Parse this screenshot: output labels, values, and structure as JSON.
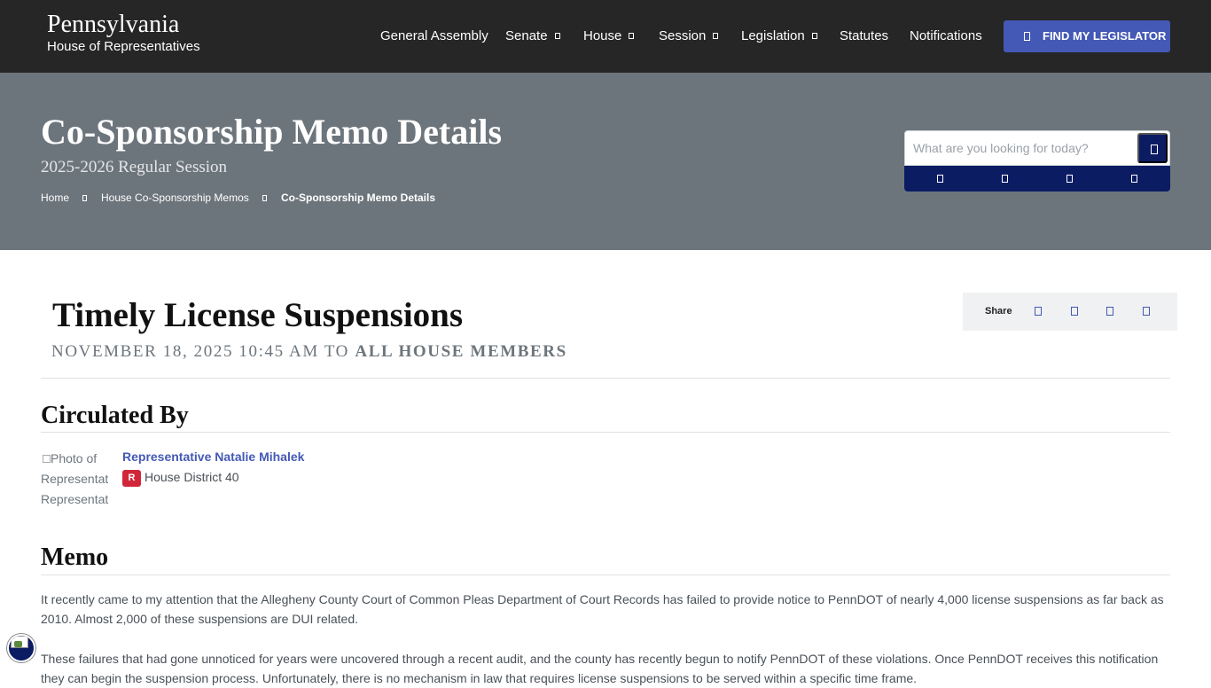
{
  "site": {
    "title": "Pennsylvania",
    "subtitle": "House of Representatives"
  },
  "nav": {
    "items": [
      {
        "label": "General Assembly",
        "has_dropdown": false
      },
      {
        "label": "Senate",
        "has_dropdown": true
      },
      {
        "label": "House",
        "has_dropdown": true
      },
      {
        "label": "Session",
        "has_dropdown": true
      },
      {
        "label": "Legislation",
        "has_dropdown": true
      },
      {
        "label": "Statutes",
        "has_dropdown": false
      },
      {
        "label": "Notifications",
        "has_dropdown": false
      }
    ],
    "cta_label": "FIND MY LEGISLATOR"
  },
  "hero": {
    "title": "Co-Sponsorship Memo Details",
    "subtitle": "2025-2026 Regular Session",
    "breadcrumbs": [
      "Home",
      "House Co-Sponsorship Memos",
      "Co-Sponsorship Memo Details"
    ]
  },
  "search": {
    "placeholder": "What are you looking for today?",
    "quick_icons": [
      "quick-link-icon-1",
      "quick-link-icon-2",
      "quick-link-icon-3",
      "quick-link-icon-4"
    ]
  },
  "memo": {
    "title": "Timely License Suspensions",
    "date": "NOVEMBER 18, 2025 10:45 AM TO",
    "to": "ALL HOUSE MEMBERS"
  },
  "share": {
    "label": "Share",
    "icons": [
      "facebook-icon",
      "x-icon",
      "linkedin-icon",
      "email-icon"
    ]
  },
  "circulated": {
    "heading": "Circulated By",
    "photo_alt": "Photo of Representative Representative",
    "rep_name": "Representative Natalie Mihalek",
    "party": "R",
    "district": "House District 40"
  },
  "memo_body": {
    "heading": "Memo",
    "paragraphs": [
      "It recently came to my attention that the Allegheny County Court of Common Pleas Department of Court Records has failed to provide notice to PennDOT of nearly 4,000 license suspensions as far back as 2010. Almost 2,000 of these suspensions are DUI related.",
      "These failures that had gone unnoticed for years were uncovered through a recent audit, and the county has recently begun to notify PennDOT of these violations. Once PennDOT receives this notification they can begin the suspension process. Unfortunately, there is no mechanism in law that requires license suspensions to be served within a specific time frame."
    ]
  },
  "colors": {
    "nav_bg": "#262626",
    "hero_bg": "#6d757c",
    "accent": "#4459b5",
    "navy": "#0b1c63",
    "party_r": "#d1263a"
  }
}
